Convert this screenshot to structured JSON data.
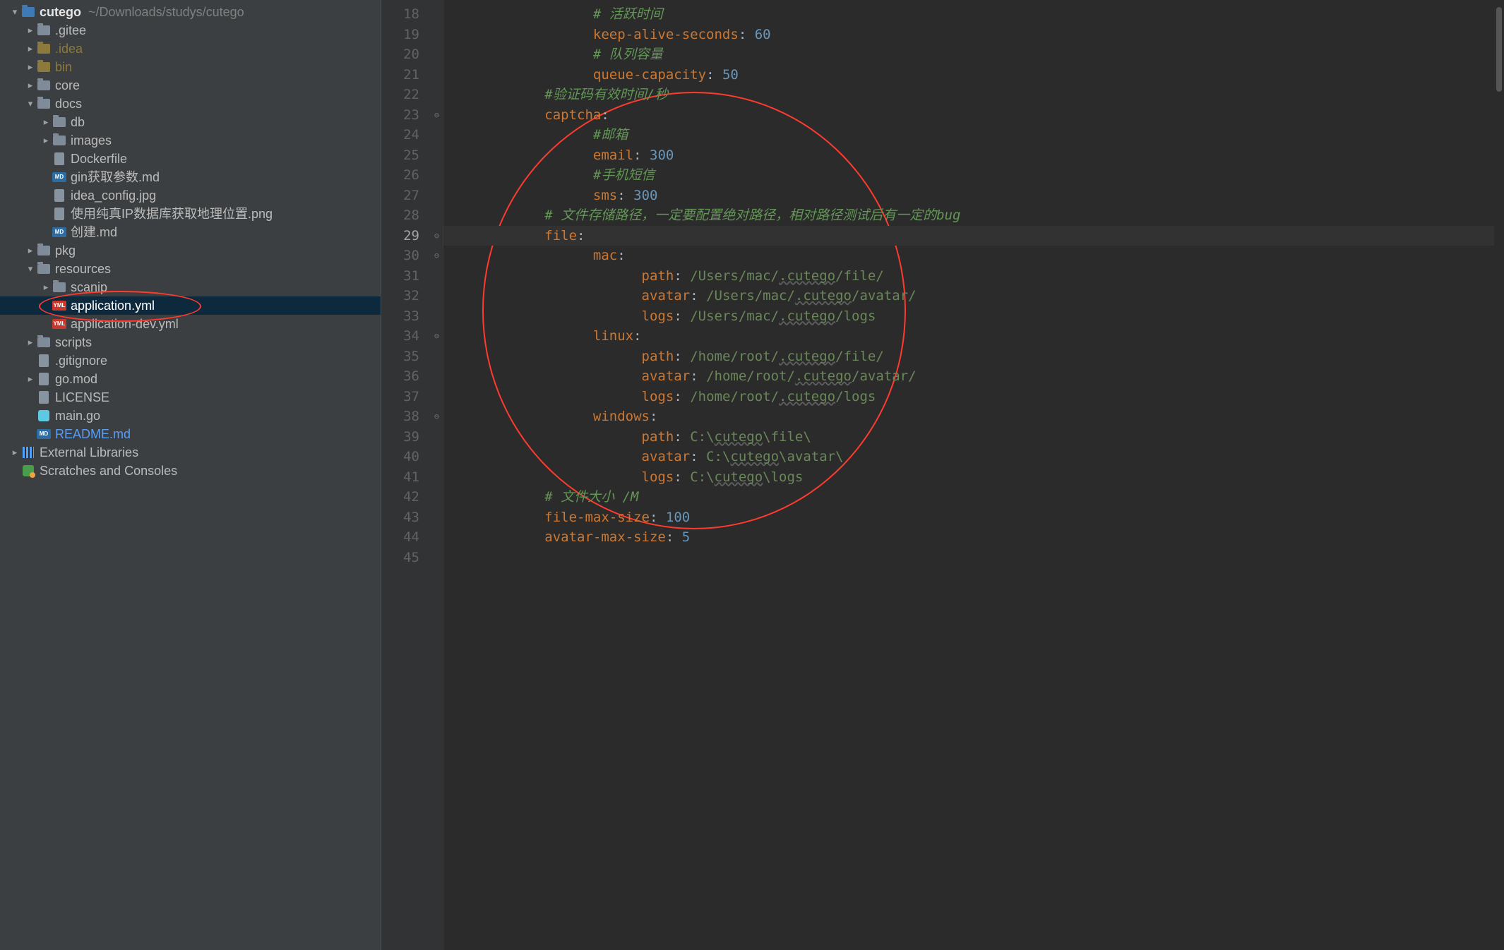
{
  "project": {
    "root_name": "cutego",
    "root_path": "~/Downloads/studys/cutego"
  },
  "tree": [
    {
      "depth": 0,
      "arrow": "down",
      "icon": "folder-module",
      "label": "cutego",
      "bold": true,
      "hint": "~/Downloads/studys/cutego"
    },
    {
      "depth": 1,
      "arrow": "right",
      "icon": "folder",
      "label": ".gitee"
    },
    {
      "depth": 1,
      "arrow": "right",
      "icon": "folder-ex",
      "label": ".idea",
      "style": "excluded"
    },
    {
      "depth": 1,
      "arrow": "right",
      "icon": "folder-ex",
      "label": "bin",
      "style": "excluded"
    },
    {
      "depth": 1,
      "arrow": "right",
      "icon": "folder",
      "label": "core"
    },
    {
      "depth": 1,
      "arrow": "down",
      "icon": "folder",
      "label": "docs"
    },
    {
      "depth": 2,
      "arrow": "right",
      "icon": "folder",
      "label": "db"
    },
    {
      "depth": 2,
      "arrow": "right",
      "icon": "folder",
      "label": "images"
    },
    {
      "depth": 2,
      "arrow": "",
      "icon": "file",
      "label": "Dockerfile"
    },
    {
      "depth": 2,
      "arrow": "",
      "icon": "md",
      "label": "gin获取参数.md"
    },
    {
      "depth": 2,
      "arrow": "",
      "icon": "file",
      "label": "idea_config.jpg"
    },
    {
      "depth": 2,
      "arrow": "",
      "icon": "file",
      "label": "使用纯真IP数据库获取地理位置.png"
    },
    {
      "depth": 2,
      "arrow": "",
      "icon": "md",
      "label": "创建.md"
    },
    {
      "depth": 1,
      "arrow": "right",
      "icon": "folder",
      "label": "pkg"
    },
    {
      "depth": 1,
      "arrow": "down",
      "icon": "folder",
      "label": "resources"
    },
    {
      "depth": 2,
      "arrow": "right",
      "icon": "folder",
      "label": "scanip"
    },
    {
      "depth": 2,
      "arrow": "",
      "icon": "yml",
      "label": "application.yml",
      "selected": true
    },
    {
      "depth": 2,
      "arrow": "",
      "icon": "yml",
      "label": "application-dev.yml"
    },
    {
      "depth": 1,
      "arrow": "right",
      "icon": "folder",
      "label": "scripts"
    },
    {
      "depth": 1,
      "arrow": "",
      "icon": "file",
      "label": ".gitignore"
    },
    {
      "depth": 1,
      "arrow": "right",
      "icon": "file",
      "label": "go.mod"
    },
    {
      "depth": 1,
      "arrow": "",
      "icon": "file",
      "label": "LICENSE"
    },
    {
      "depth": 1,
      "arrow": "",
      "icon": "go",
      "label": "main.go"
    },
    {
      "depth": 1,
      "arrow": "",
      "icon": "md",
      "label": "README.md",
      "style": "highlight"
    },
    {
      "depth": 0,
      "arrow": "right",
      "icon": "lib",
      "label": "External Libraries"
    },
    {
      "depth": 0,
      "arrow": "",
      "icon": "scratch",
      "label": "Scratches and Consoles"
    }
  ],
  "icon_text": {
    "yml": "YML",
    "md": "MD"
  },
  "editor": {
    "first_line_no": 18,
    "current_line_no": 29,
    "fold_glyph": "⊖",
    "lines": [
      {
        "tokens": [
          {
            "t": "indent",
            "n": 3
          },
          {
            "t": "comment",
            "v": "# 活跃时间"
          }
        ]
      },
      {
        "tokens": [
          {
            "t": "indent",
            "n": 3
          },
          {
            "t": "key",
            "v": "keep-alive-seconds"
          },
          {
            "t": "plain",
            "v": ": "
          },
          {
            "t": "num",
            "v": "60"
          }
        ]
      },
      {
        "tokens": [
          {
            "t": "indent",
            "n": 3
          },
          {
            "t": "comment",
            "v": "# 队列容量"
          }
        ]
      },
      {
        "tokens": [
          {
            "t": "indent",
            "n": 3
          },
          {
            "t": "key",
            "v": "queue-capacity"
          },
          {
            "t": "plain",
            "v": ": "
          },
          {
            "t": "num",
            "v": "50"
          }
        ]
      },
      {
        "tokens": [
          {
            "t": "indent",
            "n": 2
          },
          {
            "t": "comment",
            "v": "#验证码有效时间/秒"
          }
        ]
      },
      {
        "tokens": [
          {
            "t": "indent",
            "n": 2
          },
          {
            "t": "key",
            "v": "captcha"
          },
          {
            "t": "plain",
            "v": ":"
          }
        ],
        "fold": true
      },
      {
        "tokens": [
          {
            "t": "indent",
            "n": 3
          },
          {
            "t": "comment",
            "v": "#邮箱"
          }
        ]
      },
      {
        "tokens": [
          {
            "t": "indent",
            "n": 3
          },
          {
            "t": "key",
            "v": "email"
          },
          {
            "t": "plain",
            "v": ": "
          },
          {
            "t": "num",
            "v": "300"
          }
        ]
      },
      {
        "tokens": [
          {
            "t": "indent",
            "n": 3
          },
          {
            "t": "comment",
            "v": "#手机短信"
          }
        ]
      },
      {
        "tokens": [
          {
            "t": "indent",
            "n": 3
          },
          {
            "t": "key",
            "v": "sms"
          },
          {
            "t": "plain",
            "v": ": "
          },
          {
            "t": "num",
            "v": "300"
          }
        ]
      },
      {
        "tokens": [
          {
            "t": "indent",
            "n": 2
          },
          {
            "t": "comment",
            "v": "# 文件存储路径，一定要配置绝对路径，相对路径测试后有一定的bug"
          }
        ]
      },
      {
        "tokens": [
          {
            "t": "indent",
            "n": 2
          },
          {
            "t": "key",
            "v": "file"
          },
          {
            "t": "plain",
            "v": ":"
          }
        ],
        "fold": true,
        "current": true
      },
      {
        "tokens": [
          {
            "t": "indent",
            "n": 3
          },
          {
            "t": "key",
            "v": "mac"
          },
          {
            "t": "plain",
            "v": ":"
          }
        ],
        "fold": true
      },
      {
        "tokens": [
          {
            "t": "indent",
            "n": 4
          },
          {
            "t": "key",
            "v": "path"
          },
          {
            "t": "plain",
            "v": ": "
          },
          {
            "t": "str",
            "v": "/Users/mac/"
          },
          {
            "t": "part",
            "v": ".cutego",
            "wavy": true
          },
          {
            "t": "str",
            "v": "/file/"
          }
        ]
      },
      {
        "tokens": [
          {
            "t": "indent",
            "n": 4
          },
          {
            "t": "key",
            "v": "avatar"
          },
          {
            "t": "plain",
            "v": ": "
          },
          {
            "t": "str",
            "v": "/Users/mac/"
          },
          {
            "t": "part",
            "v": ".cutego",
            "wavy": true
          },
          {
            "t": "str",
            "v": "/avatar/"
          }
        ]
      },
      {
        "tokens": [
          {
            "t": "indent",
            "n": 4
          },
          {
            "t": "key",
            "v": "logs"
          },
          {
            "t": "plain",
            "v": ": "
          },
          {
            "t": "str",
            "v": "/Users/mac/"
          },
          {
            "t": "part",
            "v": ".cutego",
            "wavy": true
          },
          {
            "t": "str",
            "v": "/logs"
          }
        ]
      },
      {
        "tokens": [
          {
            "t": "indent",
            "n": 3
          },
          {
            "t": "key",
            "v": "linux"
          },
          {
            "t": "plain",
            "v": ":"
          }
        ],
        "fold": true
      },
      {
        "tokens": [
          {
            "t": "indent",
            "n": 4
          },
          {
            "t": "key",
            "v": "path"
          },
          {
            "t": "plain",
            "v": ": "
          },
          {
            "t": "str",
            "v": "/home/root/"
          },
          {
            "t": "part",
            "v": ".cutego",
            "wavy": true
          },
          {
            "t": "str",
            "v": "/file/"
          }
        ]
      },
      {
        "tokens": [
          {
            "t": "indent",
            "n": 4
          },
          {
            "t": "key",
            "v": "avatar"
          },
          {
            "t": "plain",
            "v": ": "
          },
          {
            "t": "str",
            "v": "/home/root/"
          },
          {
            "t": "part",
            "v": ".cutego",
            "wavy": true
          },
          {
            "t": "str",
            "v": "/avatar/"
          }
        ]
      },
      {
        "tokens": [
          {
            "t": "indent",
            "n": 4
          },
          {
            "t": "key",
            "v": "logs"
          },
          {
            "t": "plain",
            "v": ": "
          },
          {
            "t": "str",
            "v": "/home/root/"
          },
          {
            "t": "part",
            "v": ".cutego",
            "wavy": true
          },
          {
            "t": "str",
            "v": "/logs"
          }
        ]
      },
      {
        "tokens": [
          {
            "t": "indent",
            "n": 3
          },
          {
            "t": "key",
            "v": "windows"
          },
          {
            "t": "plain",
            "v": ":"
          }
        ],
        "fold": true
      },
      {
        "tokens": [
          {
            "t": "indent",
            "n": 4
          },
          {
            "t": "key",
            "v": "path"
          },
          {
            "t": "plain",
            "v": ": "
          },
          {
            "t": "str",
            "v": "C:\\"
          },
          {
            "t": "part",
            "v": "cutego",
            "wavy": true
          },
          {
            "t": "str",
            "v": "\\file\\"
          }
        ]
      },
      {
        "tokens": [
          {
            "t": "indent",
            "n": 4
          },
          {
            "t": "key",
            "v": "avatar"
          },
          {
            "t": "plain",
            "v": ": "
          },
          {
            "t": "str",
            "v": "C:\\"
          },
          {
            "t": "part",
            "v": "cutego",
            "wavy": true
          },
          {
            "t": "str",
            "v": "\\avatar\\"
          }
        ]
      },
      {
        "tokens": [
          {
            "t": "indent",
            "n": 4
          },
          {
            "t": "key",
            "v": "logs"
          },
          {
            "t": "plain",
            "v": ": "
          },
          {
            "t": "str",
            "v": "C:\\"
          },
          {
            "t": "part",
            "v": "cutego",
            "wavy": true
          },
          {
            "t": "str",
            "v": "\\logs"
          }
        ]
      },
      {
        "tokens": [
          {
            "t": "indent",
            "n": 2
          },
          {
            "t": "comment",
            "v": "# 文件大小 /M"
          }
        ]
      },
      {
        "tokens": [
          {
            "t": "indent",
            "n": 2
          },
          {
            "t": "key",
            "v": "file-max-size"
          },
          {
            "t": "plain",
            "v": ": "
          },
          {
            "t": "num",
            "v": "100"
          }
        ]
      },
      {
        "tokens": [
          {
            "t": "indent",
            "n": 2
          },
          {
            "t": "key",
            "v": "avatar-max-size"
          },
          {
            "t": "plain",
            "v": ": "
          },
          {
            "t": "num",
            "v": "5"
          }
        ]
      },
      {
        "tokens": []
      }
    ]
  }
}
